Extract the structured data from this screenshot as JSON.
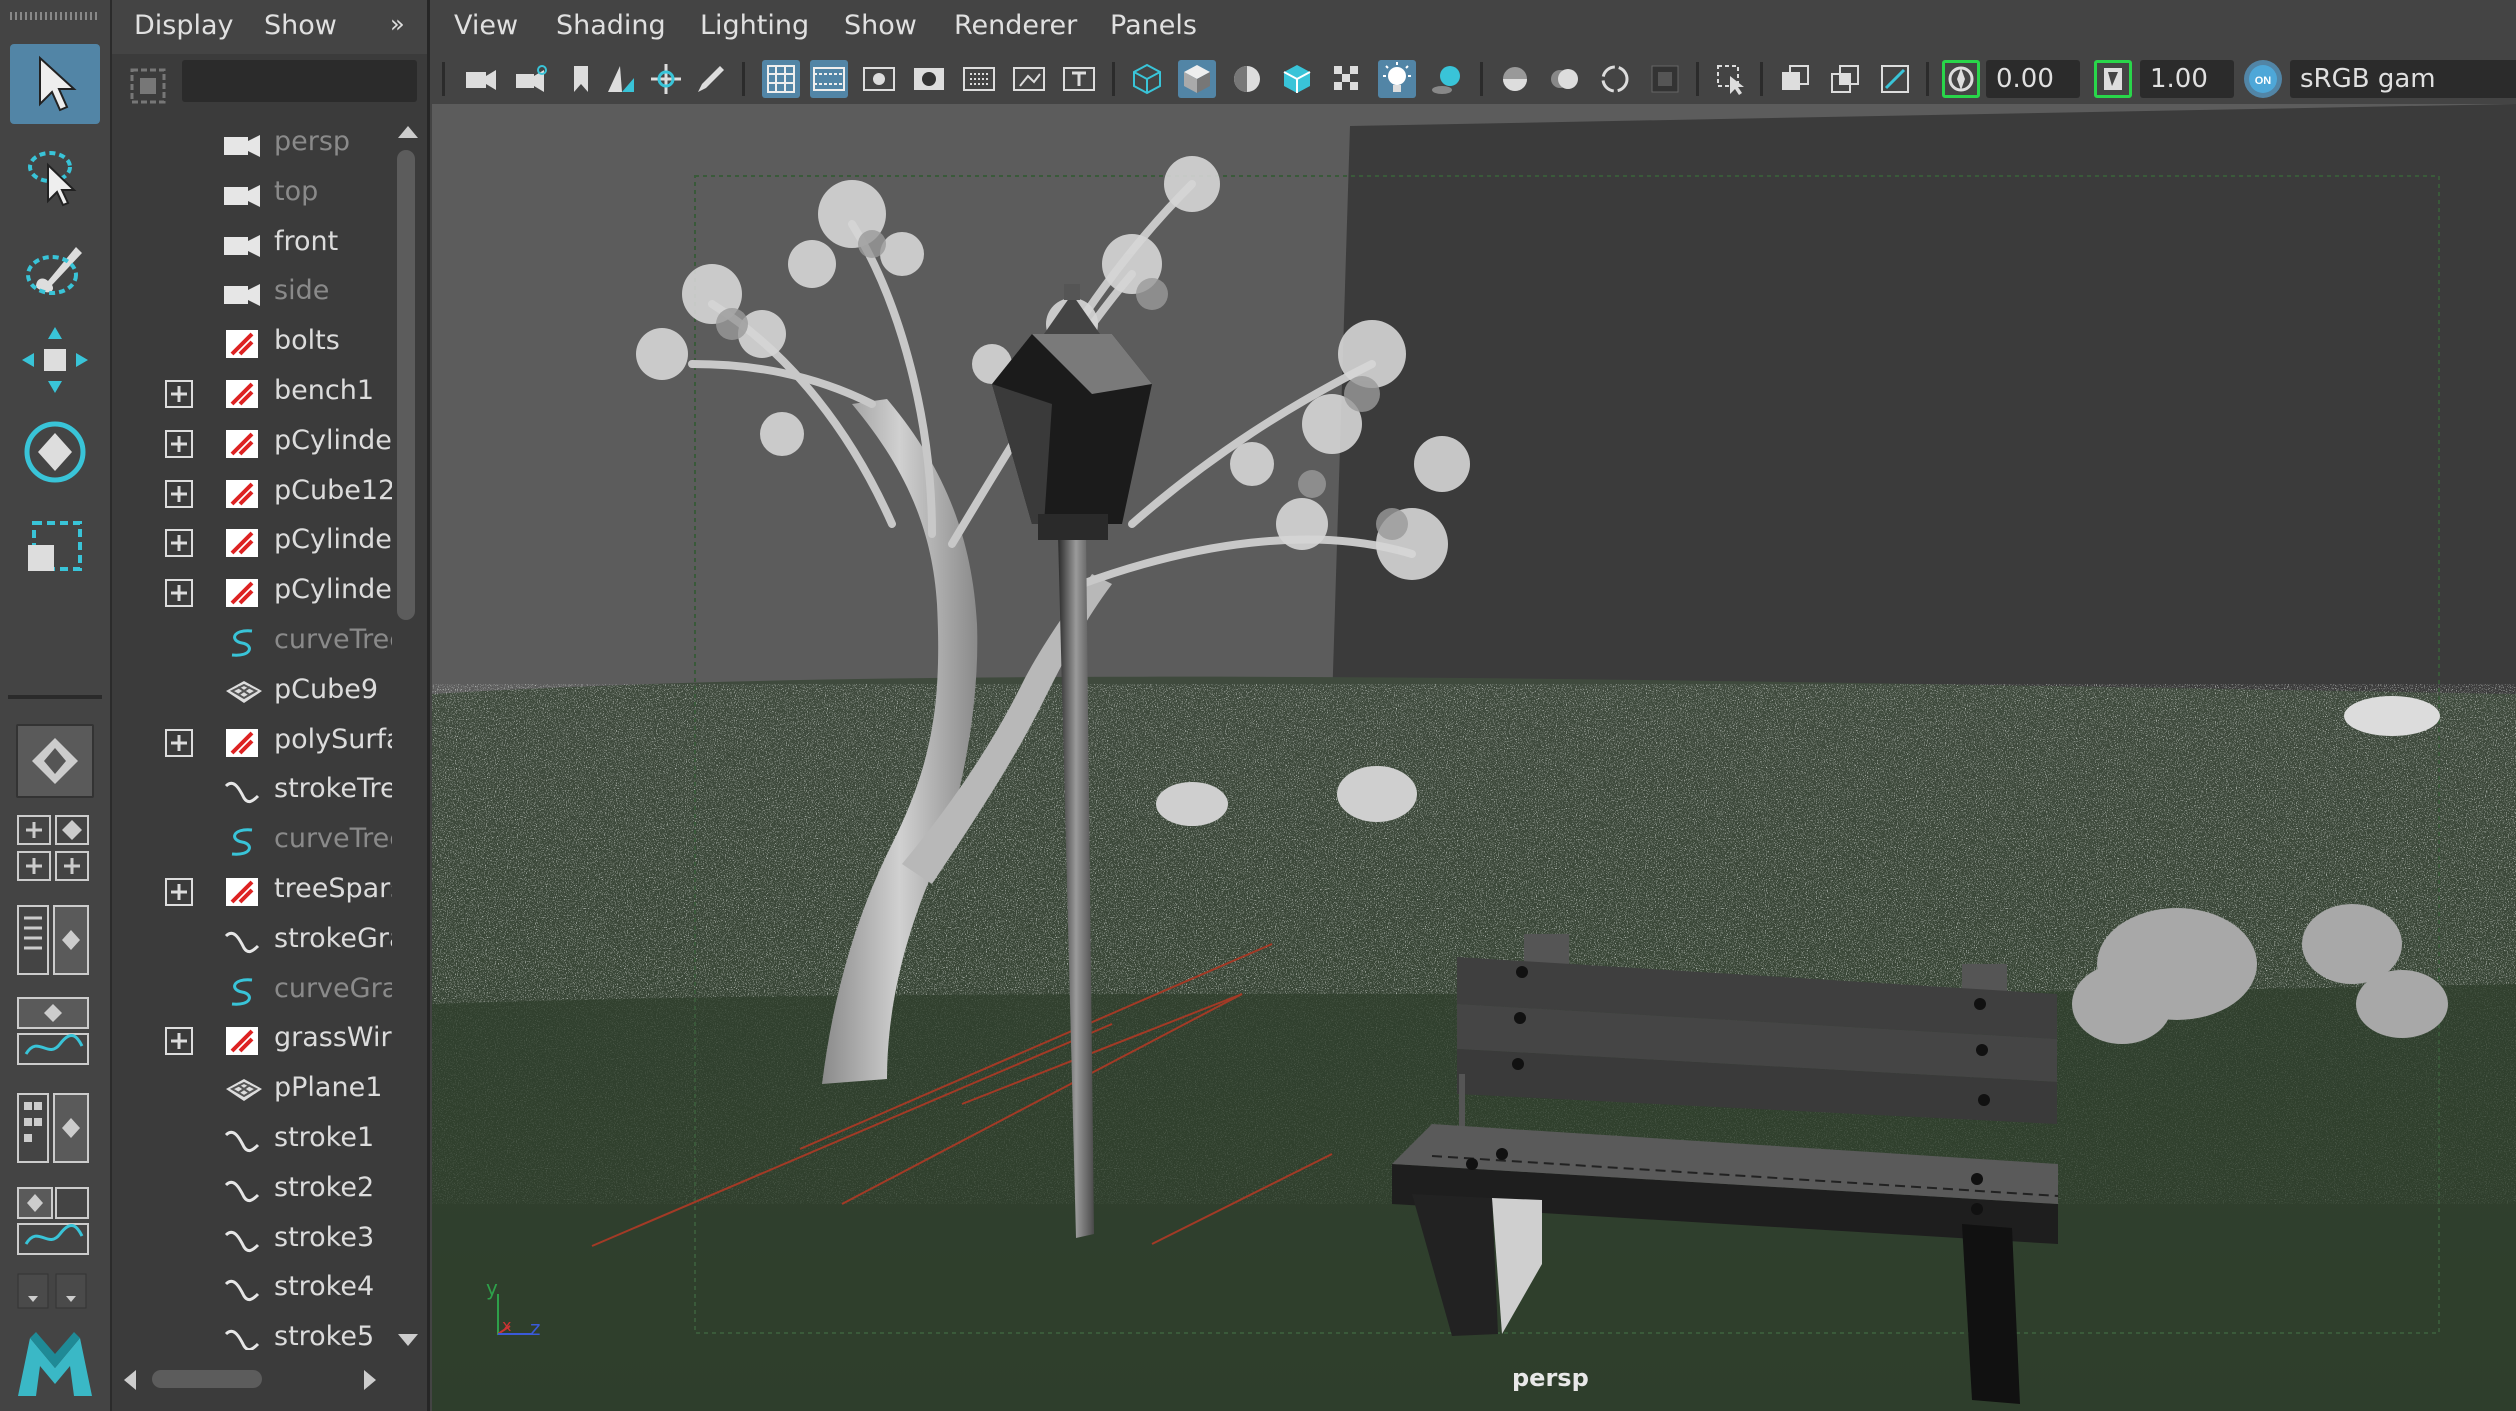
{
  "toolbox": {
    "tools": [
      "select-tool",
      "lasso-tool",
      "paint-select-tool",
      "move-tool",
      "rotate-tool",
      "scale-tool"
    ],
    "active_tool": "select-tool"
  },
  "outliner": {
    "menu": {
      "display": "Display",
      "show": "Show",
      "more": "»"
    },
    "items": [
      {
        "label": "persp",
        "type": "camera",
        "dim": true,
        "expandable": false
      },
      {
        "label": "top",
        "type": "camera",
        "dim": true,
        "expandable": false
      },
      {
        "label": "front",
        "type": "camera",
        "dim": false,
        "expandable": false
      },
      {
        "label": "side",
        "type": "camera",
        "dim": true,
        "expandable": false
      },
      {
        "label": "bolts",
        "type": "mesh",
        "dim": false,
        "expandable": false
      },
      {
        "label": "bench1",
        "type": "mesh",
        "dim": false,
        "expandable": true
      },
      {
        "label": "pCylinde",
        "type": "mesh",
        "dim": false,
        "expandable": true
      },
      {
        "label": "pCube12",
        "type": "mesh",
        "dim": false,
        "expandable": true
      },
      {
        "label": "pCylinde",
        "type": "mesh",
        "dim": false,
        "expandable": true
      },
      {
        "label": "pCylinde",
        "type": "mesh",
        "dim": false,
        "expandable": true
      },
      {
        "label": "curveTree",
        "type": "curve",
        "dim": true,
        "expandable": false
      },
      {
        "label": "pCube9",
        "type": "poly",
        "dim": false,
        "expandable": false
      },
      {
        "label": "polySurfa",
        "type": "mesh",
        "dim": false,
        "expandable": true
      },
      {
        "label": "strokeTre",
        "type": "stroke",
        "dim": false,
        "expandable": false
      },
      {
        "label": "curveTree",
        "type": "curve",
        "dim": true,
        "expandable": false
      },
      {
        "label": "treeSpars",
        "type": "mesh",
        "dim": false,
        "expandable": true
      },
      {
        "label": "strokeGra",
        "type": "stroke",
        "dim": false,
        "expandable": false
      },
      {
        "label": "curveGra",
        "type": "curve",
        "dim": true,
        "expandable": false
      },
      {
        "label": "grassWir",
        "type": "mesh",
        "dim": false,
        "expandable": true
      },
      {
        "label": "pPlane1",
        "type": "poly",
        "dim": false,
        "expandable": false
      },
      {
        "label": "stroke1",
        "type": "stroke",
        "dim": false,
        "expandable": false
      },
      {
        "label": "stroke2",
        "type": "stroke",
        "dim": false,
        "expandable": false
      },
      {
        "label": "stroke3",
        "type": "stroke",
        "dim": false,
        "expandable": false
      },
      {
        "label": "stroke4",
        "type": "stroke",
        "dim": false,
        "expandable": false
      },
      {
        "label": "stroke5",
        "type": "stroke",
        "dim": false,
        "expandable": false
      }
    ]
  },
  "panel": {
    "menu": {
      "view": "View",
      "shading": "Shading",
      "lighting": "Lighting",
      "show": "Show",
      "renderer": "Renderer",
      "panels": "Panels"
    },
    "exposure_value": "0.00",
    "gamma_value": "1.00",
    "color_space": "sRGB gam",
    "camera_label": "persp",
    "axis": {
      "x": "x",
      "y": "y",
      "z": "z"
    }
  },
  "colors": {
    "accent": "#5285a6",
    "bg": "#444444",
    "grass": "#344332",
    "wall": "#3b3b3b",
    "sky": "#5e5e5e",
    "green_icon": "#29d64a"
  }
}
